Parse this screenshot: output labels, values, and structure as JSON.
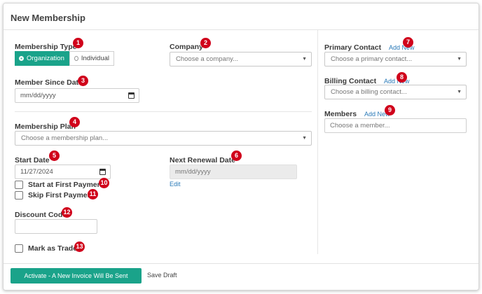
{
  "window": {
    "title": "New Membership"
  },
  "badges": [
    "1",
    "2",
    "3",
    "4",
    "5",
    "6",
    "7",
    "8",
    "9",
    "10",
    "11",
    "12",
    "13"
  ],
  "membership_type": {
    "label": "Membership Type",
    "options": [
      "Organization",
      "Individual"
    ],
    "selected": "Organization"
  },
  "company": {
    "label": "Company",
    "placeholder": "Choose a company..."
  },
  "member_since": {
    "label": "Member Since Date",
    "value": "mm/dd/yyyy"
  },
  "membership_plan": {
    "label": "Membership Plan",
    "placeholder": "Choose a membership plan..."
  },
  "start_date": {
    "label": "Start Date",
    "value": "11/27/2024"
  },
  "next_renewal": {
    "label": "Next Renewal Date",
    "value": "mm/dd/yyyy",
    "edit_label": "Edit"
  },
  "checkboxes": {
    "start_first_payment": "Start at First Payment",
    "skip_first_payment": "Skip First Payment",
    "mark_as_trade": "Mark as Trade"
  },
  "discount_code": {
    "label": "Discount Code",
    "value": ""
  },
  "primary_contact": {
    "label": "Primary Contact",
    "add_new": "Add New",
    "placeholder": "Choose a primary contact..."
  },
  "billing_contact": {
    "label": "Billing Contact",
    "add_new": "Add New",
    "placeholder": "Choose a billing contact..."
  },
  "members": {
    "label": "Members",
    "add_new": "Add New",
    "placeholder": "Choose a member..."
  },
  "footer": {
    "activate_label": "Activate - A New Invoice Will Be Sent",
    "save_draft_label": "Save Draft"
  },
  "colors": {
    "accent": "#1aa38a",
    "badge": "#d0021b",
    "link": "#2a7ab8"
  }
}
